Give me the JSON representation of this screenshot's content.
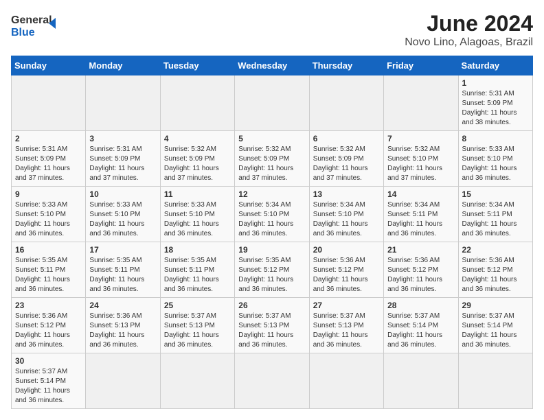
{
  "logo": {
    "line1": "General",
    "line2": "Blue"
  },
  "title": {
    "month_year": "June 2024",
    "location": "Novo Lino, Alagoas, Brazil"
  },
  "weekdays": [
    "Sunday",
    "Monday",
    "Tuesday",
    "Wednesday",
    "Thursday",
    "Friday",
    "Saturday"
  ],
  "days": [
    {
      "num": "",
      "info": ""
    },
    {
      "num": "",
      "info": ""
    },
    {
      "num": "",
      "info": ""
    },
    {
      "num": "",
      "info": ""
    },
    {
      "num": "",
      "info": ""
    },
    {
      "num": "",
      "info": ""
    },
    {
      "num": "1",
      "info": "Sunrise: 5:31 AM\nSunset: 5:09 PM\nDaylight: 11 hours and 38 minutes."
    },
    {
      "num": "2",
      "info": "Sunrise: 5:31 AM\nSunset: 5:09 PM\nDaylight: 11 hours and 37 minutes."
    },
    {
      "num": "3",
      "info": "Sunrise: 5:31 AM\nSunset: 5:09 PM\nDaylight: 11 hours and 37 minutes."
    },
    {
      "num": "4",
      "info": "Sunrise: 5:32 AM\nSunset: 5:09 PM\nDaylight: 11 hours and 37 minutes."
    },
    {
      "num": "5",
      "info": "Sunrise: 5:32 AM\nSunset: 5:09 PM\nDaylight: 11 hours and 37 minutes."
    },
    {
      "num": "6",
      "info": "Sunrise: 5:32 AM\nSunset: 5:09 PM\nDaylight: 11 hours and 37 minutes."
    },
    {
      "num": "7",
      "info": "Sunrise: 5:32 AM\nSunset: 5:10 PM\nDaylight: 11 hours and 37 minutes."
    },
    {
      "num": "8",
      "info": "Sunrise: 5:33 AM\nSunset: 5:10 PM\nDaylight: 11 hours and 36 minutes."
    },
    {
      "num": "9",
      "info": "Sunrise: 5:33 AM\nSunset: 5:10 PM\nDaylight: 11 hours and 36 minutes."
    },
    {
      "num": "10",
      "info": "Sunrise: 5:33 AM\nSunset: 5:10 PM\nDaylight: 11 hours and 36 minutes."
    },
    {
      "num": "11",
      "info": "Sunrise: 5:33 AM\nSunset: 5:10 PM\nDaylight: 11 hours and 36 minutes."
    },
    {
      "num": "12",
      "info": "Sunrise: 5:34 AM\nSunset: 5:10 PM\nDaylight: 11 hours and 36 minutes."
    },
    {
      "num": "13",
      "info": "Sunrise: 5:34 AM\nSunset: 5:10 PM\nDaylight: 11 hours and 36 minutes."
    },
    {
      "num": "14",
      "info": "Sunrise: 5:34 AM\nSunset: 5:11 PM\nDaylight: 11 hours and 36 minutes."
    },
    {
      "num": "15",
      "info": "Sunrise: 5:34 AM\nSunset: 5:11 PM\nDaylight: 11 hours and 36 minutes."
    },
    {
      "num": "16",
      "info": "Sunrise: 5:35 AM\nSunset: 5:11 PM\nDaylight: 11 hours and 36 minutes."
    },
    {
      "num": "17",
      "info": "Sunrise: 5:35 AM\nSunset: 5:11 PM\nDaylight: 11 hours and 36 minutes."
    },
    {
      "num": "18",
      "info": "Sunrise: 5:35 AM\nSunset: 5:11 PM\nDaylight: 11 hours and 36 minutes."
    },
    {
      "num": "19",
      "info": "Sunrise: 5:35 AM\nSunset: 5:12 PM\nDaylight: 11 hours and 36 minutes."
    },
    {
      "num": "20",
      "info": "Sunrise: 5:36 AM\nSunset: 5:12 PM\nDaylight: 11 hours and 36 minutes."
    },
    {
      "num": "21",
      "info": "Sunrise: 5:36 AM\nSunset: 5:12 PM\nDaylight: 11 hours and 36 minutes."
    },
    {
      "num": "22",
      "info": "Sunrise: 5:36 AM\nSunset: 5:12 PM\nDaylight: 11 hours and 36 minutes."
    },
    {
      "num": "23",
      "info": "Sunrise: 5:36 AM\nSunset: 5:12 PM\nDaylight: 11 hours and 36 minutes."
    },
    {
      "num": "24",
      "info": "Sunrise: 5:36 AM\nSunset: 5:13 PM\nDaylight: 11 hours and 36 minutes."
    },
    {
      "num": "25",
      "info": "Sunrise: 5:37 AM\nSunset: 5:13 PM\nDaylight: 11 hours and 36 minutes."
    },
    {
      "num": "26",
      "info": "Sunrise: 5:37 AM\nSunset: 5:13 PM\nDaylight: 11 hours and 36 minutes."
    },
    {
      "num": "27",
      "info": "Sunrise: 5:37 AM\nSunset: 5:13 PM\nDaylight: 11 hours and 36 minutes."
    },
    {
      "num": "28",
      "info": "Sunrise: 5:37 AM\nSunset: 5:14 PM\nDaylight: 11 hours and 36 minutes."
    },
    {
      "num": "29",
      "info": "Sunrise: 5:37 AM\nSunset: 5:14 PM\nDaylight: 11 hours and 36 minutes."
    },
    {
      "num": "30",
      "info": "Sunrise: 5:37 AM\nSunset: 5:14 PM\nDaylight: 11 hours and 36 minutes."
    },
    {
      "num": "",
      "info": ""
    },
    {
      "num": "",
      "info": ""
    },
    {
      "num": "",
      "info": ""
    },
    {
      "num": "",
      "info": ""
    },
    {
      "num": "",
      "info": ""
    },
    {
      "num": "",
      "info": ""
    }
  ]
}
